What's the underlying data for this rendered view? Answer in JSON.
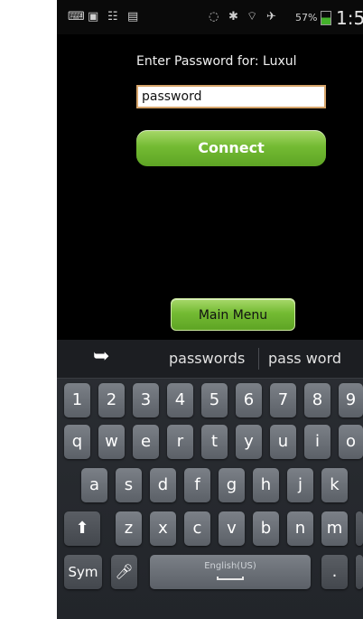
{
  "status_bar": {
    "battery_percent": "57%",
    "time": "1:5"
  },
  "prompt": "Enter Password for: Luxul",
  "password_field": {
    "value": "password"
  },
  "connect_label": "Connect",
  "main_menu_label": "Main Menu",
  "keyboard": {
    "suggestions": [
      "passwords",
      "pass word"
    ],
    "row_numbers": [
      "1",
      "2",
      "3",
      "4",
      "5",
      "6",
      "7",
      "8",
      "9"
    ],
    "row_top": [
      "q",
      "w",
      "e",
      "r",
      "t",
      "y",
      "u",
      "i",
      "o"
    ],
    "row_mid": [
      "a",
      "s",
      "d",
      "f",
      "g",
      "h",
      "j",
      "k"
    ],
    "row_bottom": [
      "z",
      "x",
      "c",
      "v",
      "b",
      "n",
      "m"
    ],
    "sym_label": "Sym",
    "space_label": "English(US)",
    "colors": {
      "key": "#6b7077",
      "keyboard_bg": "#262a2f"
    }
  },
  "colors": {
    "accent_green": "#74bb33",
    "input_border": "#d6a46a"
  }
}
